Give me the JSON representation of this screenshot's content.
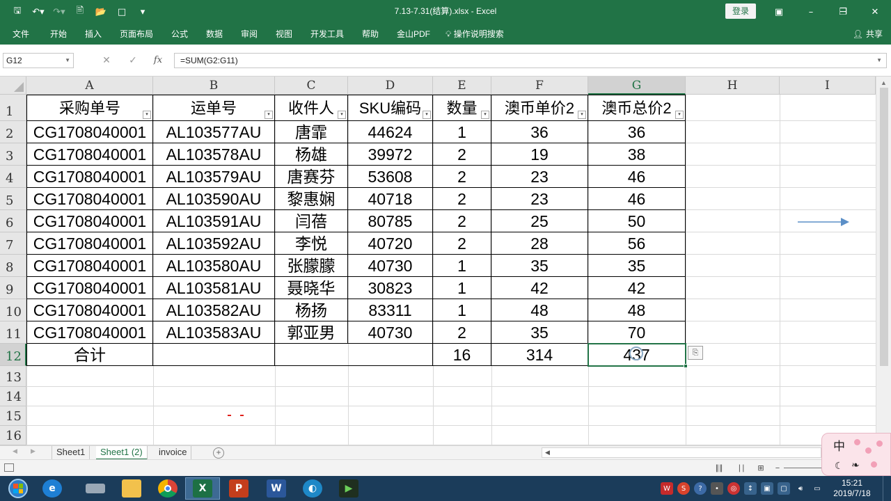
{
  "window": {
    "title": "7.13-7.31(结算).xlsx - Excel",
    "login_label": "登录",
    "share_label": "共享"
  },
  "ribbon_tabs": [
    "文件",
    "开始",
    "插入",
    "页面布局",
    "公式",
    "数据",
    "审阅",
    "视图",
    "开发工具",
    "帮助",
    "金山PDF",
    "操作说明搜索"
  ],
  "formula_bar": {
    "name_box": "G12",
    "formula": "=SUM(G2:G11)",
    "fx_label": "fx"
  },
  "columns": [
    "A",
    "B",
    "C",
    "D",
    "E",
    "F",
    "G",
    "H",
    "I"
  ],
  "selected_column": "G",
  "rows": [
    1,
    2,
    3,
    4,
    5,
    6,
    7,
    8,
    9,
    10,
    11,
    12,
    13,
    14,
    15,
    16
  ],
  "selected_row": 12,
  "table": {
    "headers": [
      "采购单号",
      "运单号",
      "收件人",
      "SKU编码",
      "数量",
      "澳币单价2",
      "澳币总价2"
    ],
    "rows": [
      [
        "CG1708040001",
        "AL103577AU",
        "唐霏",
        "44624",
        "1",
        "36",
        "36"
      ],
      [
        "CG1708040001",
        "AL103578AU",
        "杨雄",
        "39972",
        "2",
        "19",
        "38"
      ],
      [
        "CG1708040001",
        "AL103579AU",
        "唐赛芬",
        "53608",
        "2",
        "23",
        "46"
      ],
      [
        "CG1708040001",
        "AL103590AU",
        "黎惠娴",
        "40718",
        "2",
        "23",
        "46"
      ],
      [
        "CG1708040001",
        "AL103591AU",
        "闫蓓",
        "80785",
        "2",
        "25",
        "50"
      ],
      [
        "CG1708040001",
        "AL103592AU",
        "李悦",
        "40720",
        "2",
        "28",
        "56"
      ],
      [
        "CG1708040001",
        "AL103580AU",
        "张朦朦",
        "40730",
        "1",
        "35",
        "35"
      ],
      [
        "CG1708040001",
        "AL103581AU",
        "聂晓华",
        "30823",
        "1",
        "42",
        "42"
      ],
      [
        "CG1708040001",
        "AL103582AU",
        "杨扬",
        "83311",
        "1",
        "48",
        "48"
      ],
      [
        "CG1708040001",
        "AL103583AU",
        "郭亚男",
        "40730",
        "2",
        "35",
        "70"
      ]
    ],
    "total_row": [
      "合计",
      "",
      "",
      "",
      "16",
      "314",
      "437"
    ]
  },
  "sheet_tabs": [
    "Sheet1",
    "Sheet1 (2)",
    "invoice"
  ],
  "active_sheet": "Sheet1 (2)",
  "ime": {
    "mode_label": "中"
  },
  "taskbar": {
    "apps": [
      "ie-icon",
      "network-drive-icon",
      "folder-icon",
      "chrome-icon",
      "excel-icon",
      "powerpoint-icon",
      "word-icon",
      "browser-icon",
      "media-app-icon"
    ],
    "time": "15:21",
    "date": "2019/7/18"
  },
  "colors": {
    "accent": "#217346",
    "taskbar": "#1b3c5a",
    "ime_bg": "#fbe4ea"
  }
}
